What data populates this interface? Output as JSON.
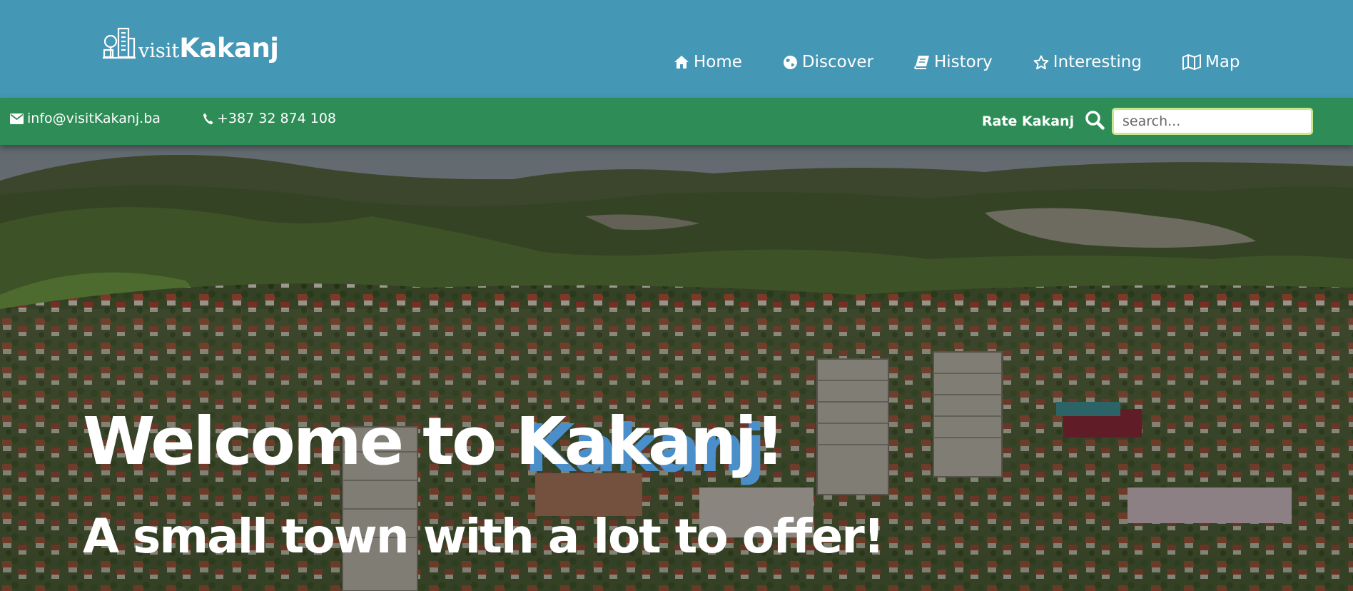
{
  "brand": {
    "prefix": "visit",
    "name": "Kakanj"
  },
  "nav": {
    "items": [
      {
        "label": "Home",
        "icon": "home-icon"
      },
      {
        "label": "Discover",
        "icon": "globe-icon"
      },
      {
        "label": "History",
        "icon": "book-icon"
      },
      {
        "label": "Interesting",
        "icon": "star-icon"
      },
      {
        "label": "Map",
        "icon": "map-icon"
      }
    ]
  },
  "contact": {
    "email": "info@visitKakanj.ba",
    "phone": "+387 32 874 108"
  },
  "toolbar": {
    "rate_label": "Rate Kakanj",
    "search_placeholder": "search..."
  },
  "hero": {
    "title_prefix": "Welcome to ",
    "title_accent": "Kakanj",
    "title_suffix": "!",
    "subtitle": "A small town with a lot to offer!"
  },
  "colors": {
    "header_bg": "#4597b6",
    "subbar_bg": "#2e8d57",
    "search_border": "#c7e98a",
    "accent_shadow": "#4a8fc9"
  }
}
